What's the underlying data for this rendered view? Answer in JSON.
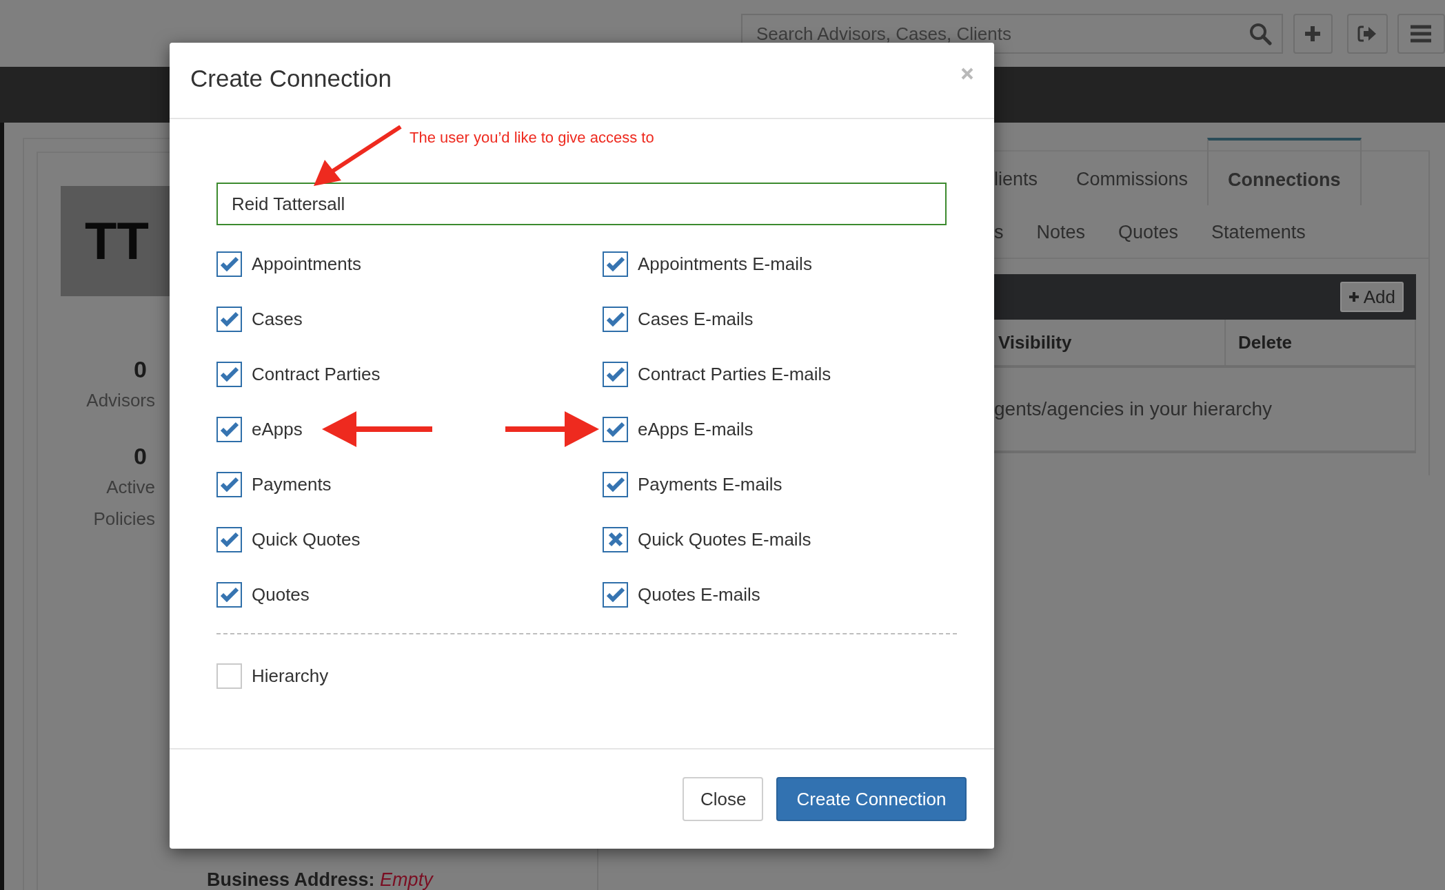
{
  "search": {
    "placeholder": "Search Advisors, Cases, Clients"
  },
  "profile": {
    "initials": "TT",
    "stats": [
      {
        "value": "0",
        "label": "Advisors"
      },
      {
        "value": "0",
        "label": "Active Policies"
      }
    ],
    "business_address": {
      "label": "Business Address:",
      "value": "Empty"
    }
  },
  "tabs_row_1": [
    {
      "label": "lients",
      "selected": false
    },
    {
      "label": "Commissions",
      "selected": false
    },
    {
      "label": "Connections",
      "selected": true
    }
  ],
  "tabs_row_2": [
    {
      "label": "s",
      "selected": false
    },
    {
      "label": "Notes",
      "selected": false
    },
    {
      "label": "Quotes",
      "selected": false
    },
    {
      "label": "Statements",
      "selected": false
    }
  ],
  "connections_table": {
    "add_button": "Add",
    "columns": [
      "Visibility",
      "Delete"
    ],
    "empty_message": "gents/agencies in your hierarchy"
  },
  "dialog": {
    "title": "Create Connection",
    "annotation": "The user you’d like to give access to",
    "user_field": {
      "value": "Reid Tattersall"
    },
    "left": [
      {
        "label": "Appointments",
        "checked": true,
        "kind": "tick"
      },
      {
        "label": "Cases",
        "checked": true,
        "kind": "tick"
      },
      {
        "label": "Contract Parties",
        "checked": true,
        "kind": "tick"
      },
      {
        "label": "eApps",
        "checked": true,
        "kind": "tick"
      },
      {
        "label": "Payments",
        "checked": true,
        "kind": "tick"
      },
      {
        "label": "Quick Quotes",
        "checked": true,
        "kind": "tick"
      },
      {
        "label": "Quotes",
        "checked": true,
        "kind": "tick"
      }
    ],
    "right": [
      {
        "label": "Appointments E-mails",
        "checked": true,
        "kind": "tick"
      },
      {
        "label": "Cases E-mails",
        "checked": true,
        "kind": "tick"
      },
      {
        "label": "Contract Parties E-mails",
        "checked": true,
        "kind": "tick"
      },
      {
        "label": "eApps E-mails",
        "checked": true,
        "kind": "tick"
      },
      {
        "label": "Payments E-mails",
        "checked": true,
        "kind": "tick"
      },
      {
        "label": "Quick Quotes E-mails",
        "checked": true,
        "kind": "cross"
      },
      {
        "label": "Quotes E-mails",
        "checked": true,
        "kind": "tick"
      }
    ],
    "hierarchy": {
      "label": "Hierarchy",
      "checked": false
    },
    "buttons": [
      {
        "label": "Close",
        "kind": "default"
      },
      {
        "label": "Create Connection",
        "kind": "primary"
      }
    ]
  }
}
